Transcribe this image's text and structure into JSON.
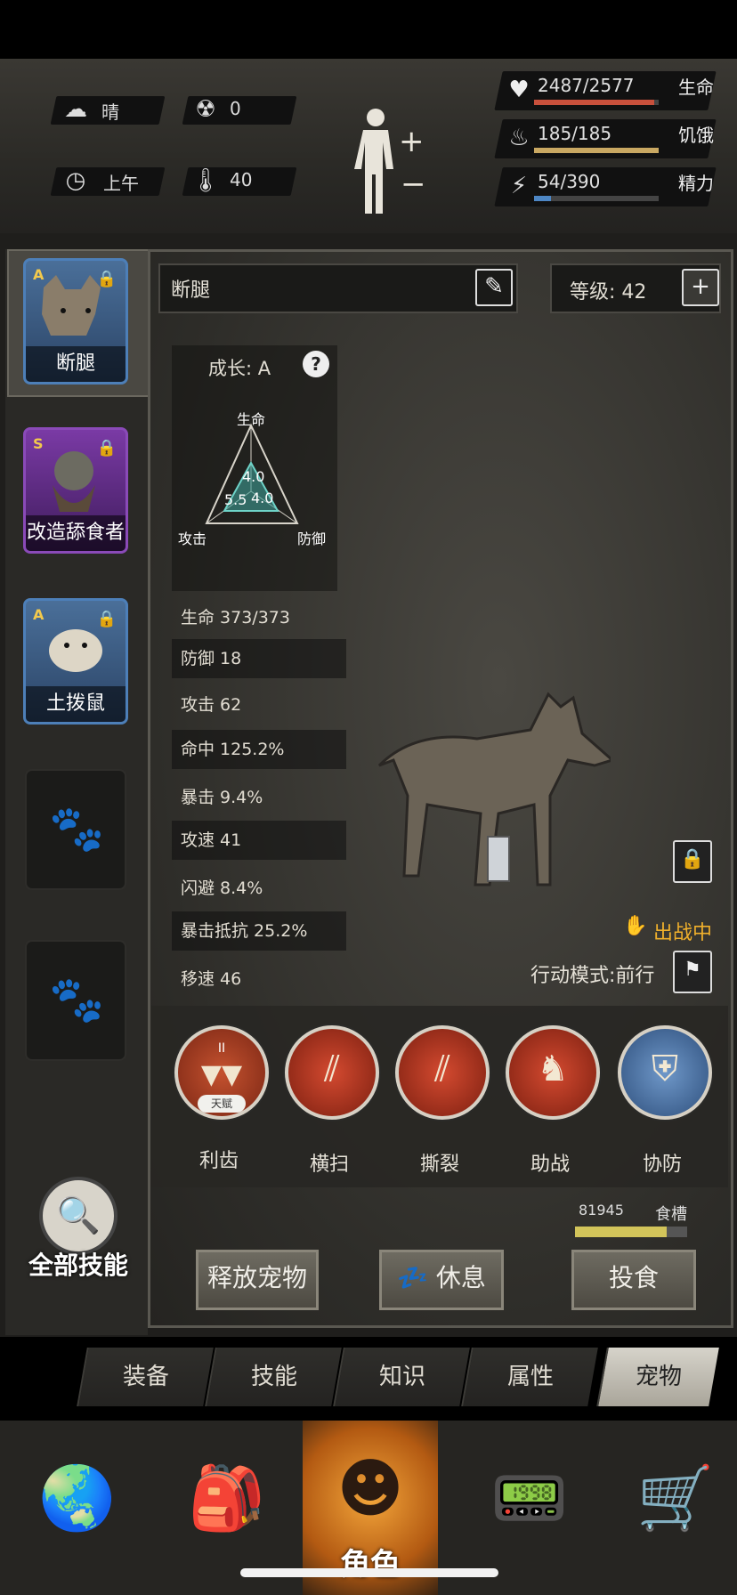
{
  "hud": {
    "weather": {
      "icon": "cloud-sun-icon",
      "label": "晴"
    },
    "radiation": {
      "icon": "radiation-icon",
      "value": "0"
    },
    "time": {
      "icon": "clock-icon",
      "label": "上午"
    },
    "temperature": {
      "icon": "thermometer-icon",
      "value": "40"
    },
    "body_icon": "body-status-icon",
    "stats": [
      {
        "icon": "heart-icon",
        "value": "2487/2577",
        "label": "生命",
        "fill": 0.965,
        "color": "#c8503c"
      },
      {
        "icon": "stomach-icon",
        "value": "185/185",
        "label": "饥饿",
        "fill": 1.0,
        "color": "#c9a862"
      },
      {
        "icon": "energy-icon",
        "value": "54/390",
        "label": "精力",
        "fill": 0.138,
        "color": "#4d86c4"
      }
    ]
  },
  "pets": [
    {
      "name": "断腿",
      "rank": "A",
      "selected": true,
      "color": "#3d6fa6"
    },
    {
      "name": "改造舔食者",
      "rank": "S",
      "selected": false,
      "color": "#7a3aa5"
    },
    {
      "name": "土拨鼠",
      "rank": "A",
      "selected": false,
      "color": "#3d6fa6"
    }
  ],
  "empty_slots": 2,
  "all_skills_label": "全部技能",
  "detail": {
    "pet_name": "断腿",
    "level_label": "等级: 42",
    "growth_label": "成长: A",
    "radar": {
      "top": "生命",
      "left": "攻击",
      "right": "防御",
      "v_top": "4.0",
      "v_left": "5.5",
      "v_right": "4.0"
    },
    "stats": [
      "生命 373/373",
      "防御 18",
      "攻击 62",
      "命中 125.2%",
      "暴击 9.4%",
      "攻速 41",
      "闪避 8.4%",
      "暴击抵抗 25.2%",
      "移速 46"
    ],
    "status": "出战中",
    "mode_label": "行动模式:前行"
  },
  "skills": [
    {
      "name": "利齿",
      "badge": "天赋",
      "roman": "II",
      "icon": "fangs-icon"
    },
    {
      "name": "横扫",
      "icon": "claw-slash-icon"
    },
    {
      "name": "撕裂",
      "icon": "claw-tear-icon"
    },
    {
      "name": "助战",
      "icon": "hunter-assist-icon"
    },
    {
      "name": "协防",
      "icon": "shield-defend-icon"
    }
  ],
  "food": {
    "value": "81945",
    "label": "食槽",
    "fill": 0.82
  },
  "actions": {
    "release": "释放宠物",
    "rest": "休息",
    "feed": "投食"
  },
  "tabs": [
    "装备",
    "技能",
    "知识",
    "属性",
    "宠物"
  ],
  "active_tab": 4,
  "nav": [
    {
      "icon": "globe-icon"
    },
    {
      "icon": "backpack-icon"
    },
    {
      "icon": "head-icon",
      "label": "角色"
    },
    {
      "icon": "walkie-talkie-icon"
    },
    {
      "icon": "cart-icon"
    }
  ]
}
